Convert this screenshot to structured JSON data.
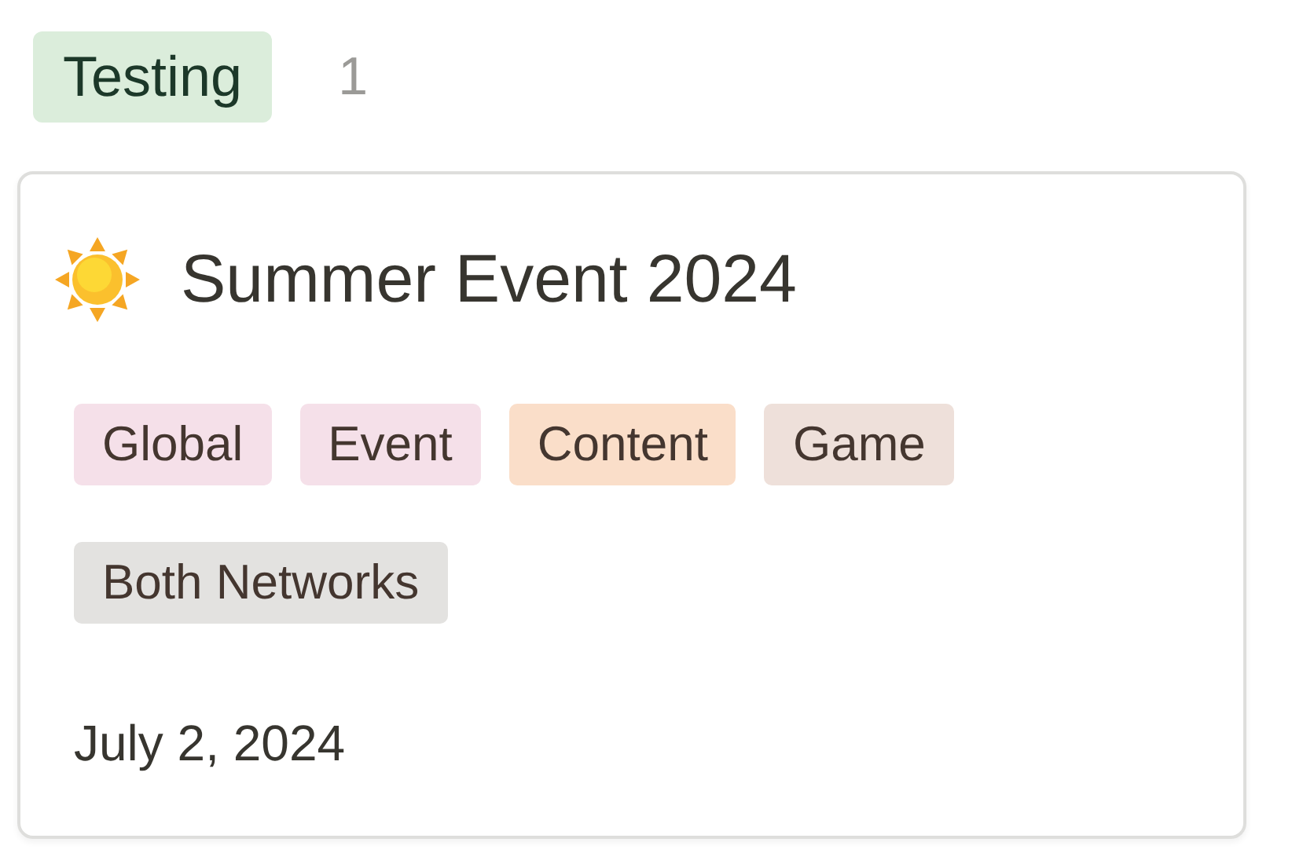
{
  "group": {
    "label": "Testing",
    "color": "#dbeddb",
    "count": "1"
  },
  "card": {
    "title": "Summer Event 2024",
    "tags": [
      {
        "label": "Global",
        "color": "#f5e0e9"
      },
      {
        "label": "Event",
        "color": "#f5e0e9"
      },
      {
        "label": "Content",
        "color": "#fadec9"
      },
      {
        "label": "Game",
        "color": "#eee0da"
      },
      {
        "label": "Both Networks",
        "color": "#e3e2e0"
      }
    ],
    "date": "July 2, 2024"
  }
}
